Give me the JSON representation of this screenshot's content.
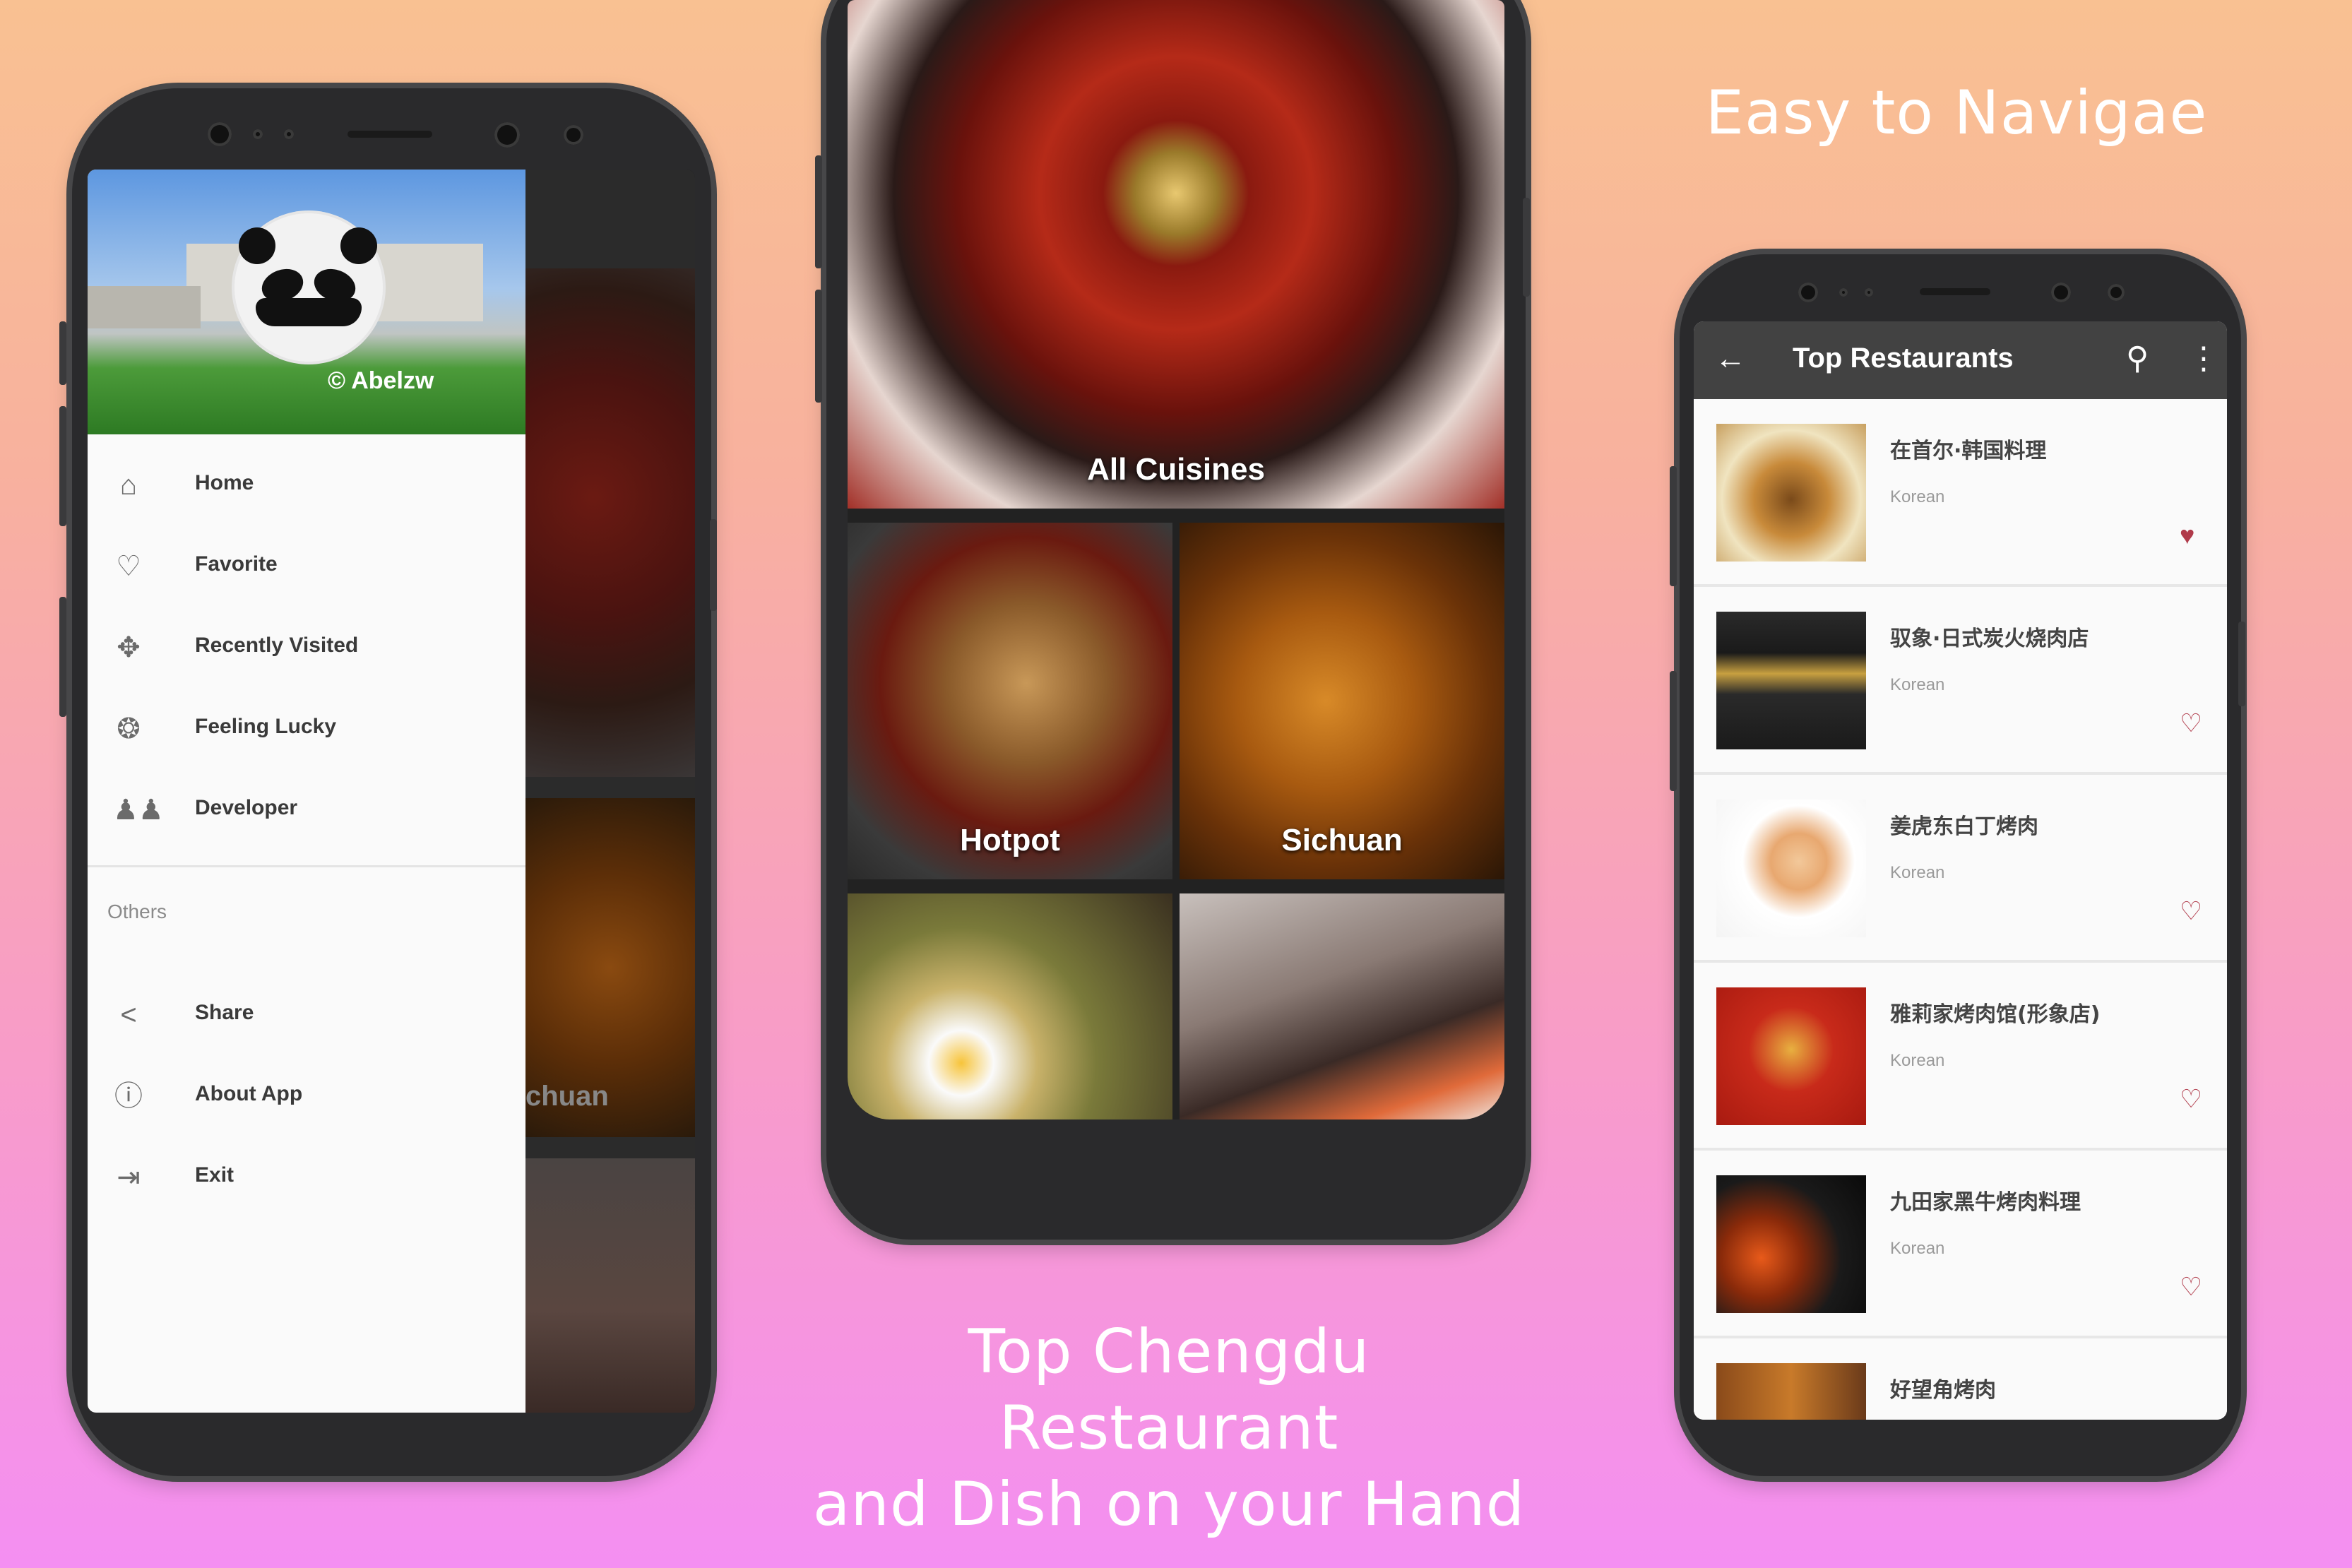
{
  "captions": {
    "top_right": "Easy to Navigae",
    "bottom_center_line1": "Top Chengdu  Restaurant",
    "bottom_center_line2": "and Dish on your Hand"
  },
  "colors": {
    "bg_top": "#f9c192",
    "bg_bottom": "#f48ff2",
    "toolbar": "#424242",
    "heart": "#b03a4a"
  },
  "drawer": {
    "header_name": "© Abelzw",
    "items": [
      {
        "label": "Home",
        "icon": "home-icon"
      },
      {
        "label": "Favorite",
        "icon": "heart-outline-icon"
      },
      {
        "label": "Recently Visited",
        "icon": "gamepad-icon"
      },
      {
        "label": "Feeling Lucky",
        "icon": "lucky-icon"
      },
      {
        "label": "Developer",
        "icon": "people-icon"
      }
    ],
    "section_title": "Others",
    "other_items": [
      {
        "label": "Share",
        "icon": "share-icon"
      },
      {
        "label": "About App",
        "icon": "info-icon"
      },
      {
        "label": "Exit",
        "icon": "exit-icon"
      }
    ],
    "background_partial_label": "chuan"
  },
  "categories": {
    "tiles": [
      {
        "label": "All Cuisines"
      },
      {
        "label": "Hotpot"
      },
      {
        "label": "Sichuan"
      }
    ]
  },
  "restaurants": {
    "toolbar_title": "Top Restaurants",
    "back_icon": "arrow-back-icon",
    "search_icon": "search-icon",
    "more_icon": "more-vert-icon",
    "items": [
      {
        "name": "在首尔·韩国料理",
        "type": "Korean",
        "favorite": true
      },
      {
        "name": "驭象·日式炭火烧肉店",
        "type": "Korean",
        "favorite": false
      },
      {
        "name": "姜虎东白丁烤肉",
        "type": "Korean",
        "favorite": false
      },
      {
        "name": "雅莉家烤肉馆(形象店)",
        "type": "Korean",
        "favorite": false
      },
      {
        "name": "九田家黑牛烤肉料理",
        "type": "Korean",
        "favorite": false
      },
      {
        "name": "好望角烤肉",
        "type": "",
        "favorite": false
      }
    ]
  }
}
